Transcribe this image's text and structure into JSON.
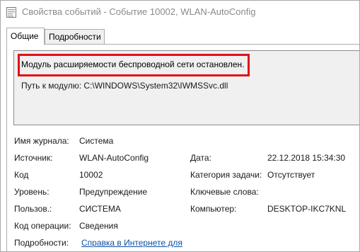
{
  "window": {
    "title": "Свойства событий - Событие 10002, WLAN-AutoConfig",
    "icon": "event-properties-icon"
  },
  "tabs": [
    {
      "label": "Общие",
      "active": true
    },
    {
      "label": "Подробности",
      "active": false
    }
  ],
  "message": {
    "text": "Модуль расширяемости беспроводной сети остановлен.",
    "module_path": "Путь к модулю: C:\\WINDOWS\\System32\\IWMSSvc.dll",
    "highlight_color": "#e0101a"
  },
  "properties": {
    "log_name": {
      "label": "Имя журнала:",
      "value": "Система"
    },
    "source": {
      "label": "Источник:",
      "value": "WLAN-AutoConfig"
    },
    "date": {
      "label": "Дата:",
      "value": "22.12.2018 15:34:30"
    },
    "event_id": {
      "label": "Код",
      "value": "10002"
    },
    "task_category": {
      "label": "Категория задачи:",
      "value": "Отсутствует"
    },
    "level": {
      "label": "Уровень:",
      "value": "Предупреждение"
    },
    "keywords": {
      "label": "Ключевые слова:",
      "value": ""
    },
    "user": {
      "label": "Пользов.:",
      "value": "СИСТЕМА"
    },
    "computer": {
      "label": "Компьютер:",
      "value": "DESKTOP-IKC7KNL"
    },
    "opcode": {
      "label": "Код операции:",
      "value": "Сведения"
    },
    "more_info": {
      "label": "Подробности:",
      "link": "Справка в Интернете для"
    }
  },
  "colors": {
    "link": "#0b4fa8",
    "message_bg": "#f0f0f0"
  }
}
